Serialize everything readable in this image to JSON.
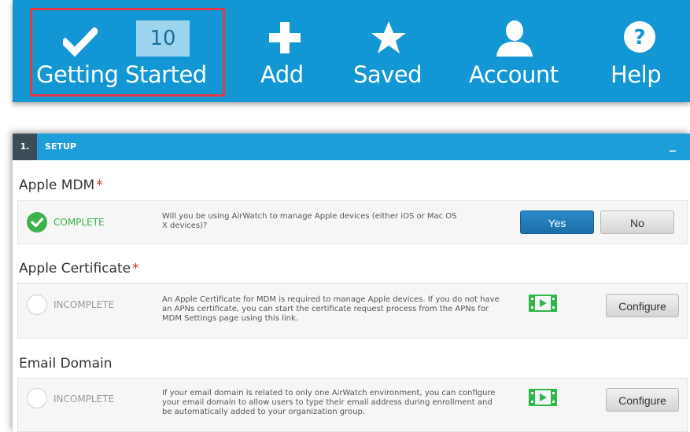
{
  "nav": {
    "items": [
      {
        "label": "Getting Started",
        "icon": "checkmark-icon",
        "badge": "10"
      },
      {
        "label": "Add",
        "icon": "plus-icon"
      },
      {
        "label": "Saved",
        "icon": "star-icon"
      },
      {
        "label": "Account",
        "icon": "user-icon"
      },
      {
        "label": "Help",
        "icon": "help-icon"
      }
    ],
    "highlight_color": "#e53945",
    "bar_color": "#1297d4"
  },
  "setup": {
    "number": "1.",
    "title": "SETUP",
    "collapse": "_",
    "groups": [
      {
        "title": "Apple MDM",
        "required": "*",
        "status": "COMPLETE",
        "description": "Will you be using AirWatch to manage Apple devices (either iOS or Mac OS X devices)?",
        "buttons": [
          "Yes",
          "No"
        ]
      },
      {
        "title": "Apple Certificate",
        "required": "*",
        "status": "INCOMPLETE",
        "description": "An Apple Certificate for MDM is required to manage Apple devices. If you do not have an APNs certificate, you can start the certificate request process from the APNs for MDM Settings page using this link.",
        "buttons": [
          "Configure"
        ],
        "icon": "video-icon"
      },
      {
        "title": "Email Domain",
        "required": "",
        "status": "INCOMPLETE",
        "description": "If your email domain is related to only one AirWatch environment, you can configure your email domain to allow users to type their email address during enrollment and be automatically added to your organization group.",
        "buttons": [
          "Configure"
        ],
        "icon": "video-icon"
      }
    ],
    "colors": {
      "complete": "#3cb34a",
      "header": "#1e9ed8"
    }
  }
}
